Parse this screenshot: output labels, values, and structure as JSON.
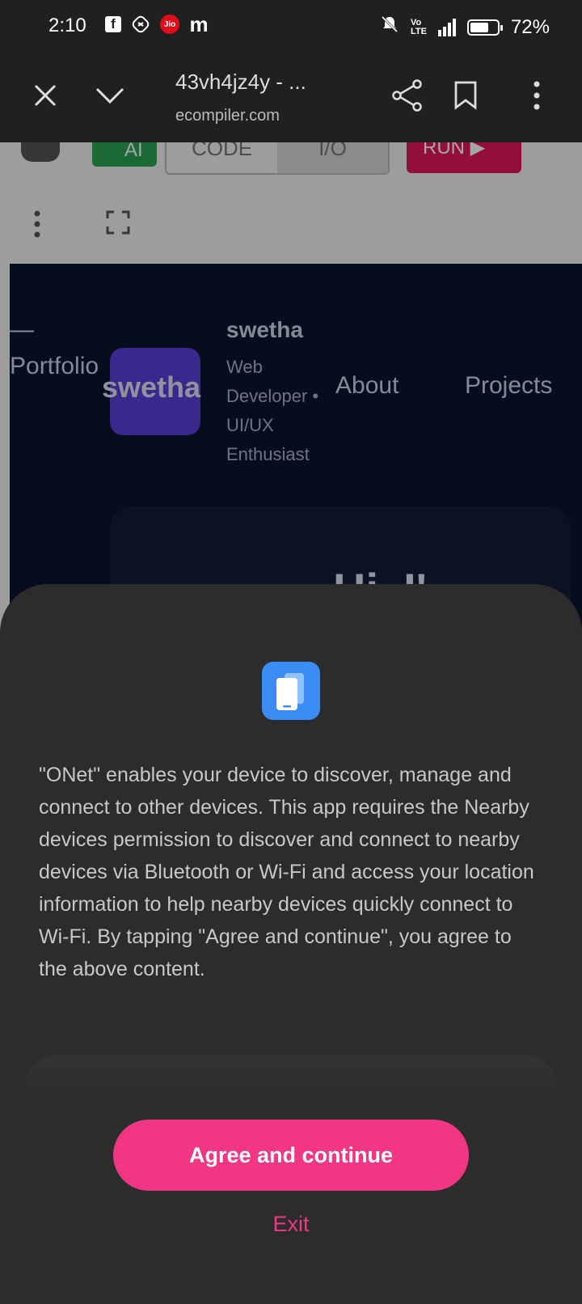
{
  "status_bar": {
    "time": "2:10",
    "battery_percent": "72%",
    "battery_level": 0.72,
    "left_icons": [
      "facebook-icon",
      "shazam-icon",
      "jio-icon",
      "m-icon"
    ],
    "jio_label": "Jio",
    "fb_label": "f",
    "m_label": "m",
    "network_label": "Vo LTE",
    "network_type": "4G"
  },
  "toolbar": {
    "title": "43vh4jz4y - ...",
    "url": "ecompiler.com"
  },
  "editor": {
    "ai_label": "AI",
    "code_tab": "CODE",
    "io_tab": "I/O",
    "run_label": "RUN ▶"
  },
  "preview": {
    "dash": "—",
    "portfolio": "Portfolio",
    "logo_text": "swetha",
    "name": "swetha",
    "tagline": "Web Developer • UI/UX Enthusiast",
    "nav": {
      "about": "About",
      "projects": "Projects"
    },
    "hero_partial": "Hi, I'"
  },
  "sheet": {
    "app_icon": "devices-icon",
    "description": "\"ONet\" enables your device to discover, manage and connect to other devices. This app requires the Nearby devices permission to discover and connect to nearby devices via Bluetooth or Wi-Fi and access your location information to help nearby devices quickly connect to Wi-Fi. By tapping \"Agree and continue\", you agree to the above content.",
    "agree_label": "Agree and continue",
    "exit_label": "Exit",
    "accent_color": "#f23683"
  }
}
